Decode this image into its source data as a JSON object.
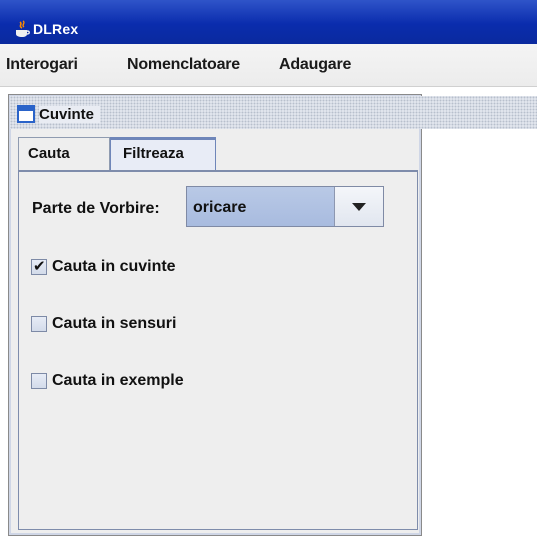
{
  "window": {
    "title": "DLRex"
  },
  "menubar": {
    "items": [
      "Interogari",
      "Nomenclatoare",
      "Adaugare"
    ]
  },
  "internal_frame": {
    "title": "Cuvinte"
  },
  "tabs": {
    "items": [
      {
        "label": "Cauta",
        "selected": false
      },
      {
        "label": "Filtreaza",
        "selected": true
      }
    ]
  },
  "filter_panel": {
    "part_of_speech": {
      "label": "Parte de Vorbire:",
      "value": "oricare"
    },
    "options": [
      {
        "label": "Cauta in cuvinte",
        "checked": true
      },
      {
        "label": "Cauta in sensuri",
        "checked": false
      },
      {
        "label": "Cauta in exemple",
        "checked": false
      }
    ]
  },
  "colors": {
    "titlebar": "#0a2cad",
    "selection": "#b9c9e6"
  }
}
